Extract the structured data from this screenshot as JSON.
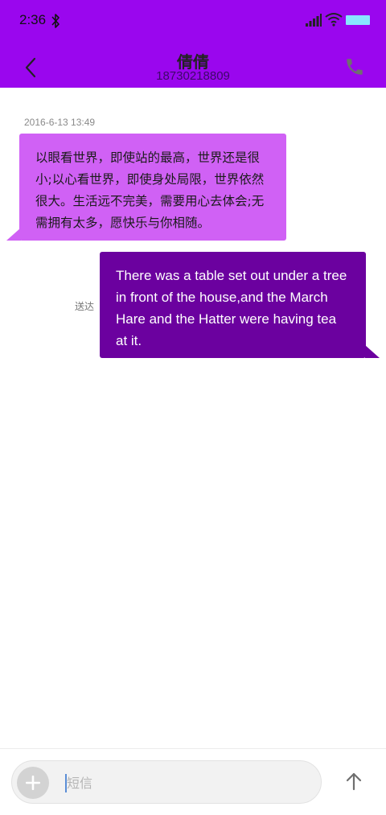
{
  "status_bar": {
    "time": "2:36",
    "icons": [
      "bluetooth-icon",
      "signal-icon",
      "wifi-icon",
      "battery-icon"
    ]
  },
  "header": {
    "contact_name": "倩倩",
    "contact_number": "18730218809",
    "back_icon": "chevron-left-icon",
    "call_icon": "phone-icon"
  },
  "conversation": {
    "timestamp": "2016-6-13 13:49",
    "messages": [
      {
        "direction": "incoming",
        "text": "以眼看世界，即使站的最高，世界还是很小;以心看世界，即使身处局限，世界依然很大。生活远不完美，需要用心去体会;无需拥有太多，愿快乐与你相随。"
      },
      {
        "direction": "outgoing",
        "text": "There was a table set out under a tree in front of the house,and the March Hare and the Hatter were having tea at it.",
        "status": "送达"
      }
    ]
  },
  "composer": {
    "placeholder": "短信",
    "value": "",
    "add_icon": "plus-icon",
    "send_icon": "arrow-up-icon"
  },
  "colors": {
    "header_bg": "#9a06ee",
    "incoming_bubble": "#d061f5",
    "outgoing_bubble": "#6b019f"
  }
}
